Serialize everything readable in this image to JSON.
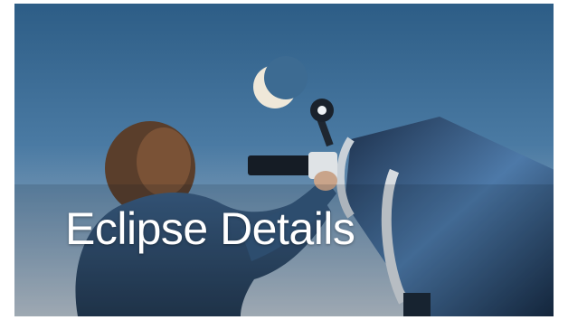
{
  "hero": {
    "title": "Eclipse Details",
    "image_subject": "person-using-telescope-icon"
  },
  "colors": {
    "sky_top": "#2d5d86",
    "sky_bottom": "#b9c3cc",
    "title_text": "#ffffff"
  }
}
